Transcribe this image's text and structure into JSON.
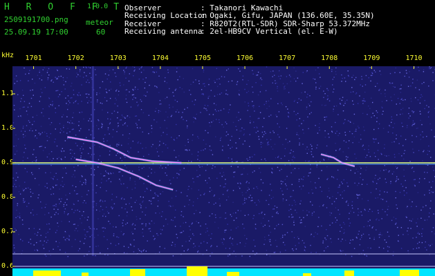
{
  "header": {
    "brand": "H R O F F T",
    "version": "1.0.0",
    "filename": "2509191700.png",
    "datetime": "25.09.19 17:00",
    "count_label": "meteor",
    "count_value": "60",
    "info": [
      {
        "label": "Observer",
        "value": ": Takanori Kawachi"
      },
      {
        "label": "Receiving Location",
        "value": ": Ogaki, Gifu, JAPAN (136.60E, 35.35N)"
      },
      {
        "label": "Receiver",
        "value": ": R820T2(RTL-SDR) SDR-Sharp 53.372MHz"
      },
      {
        "label": "Receiving antenna",
        "value": ": 2el-HB9CV Vertical (el. E-W)"
      }
    ]
  },
  "colors": {
    "background": "#000000",
    "plot_background": "#1a1a66",
    "tick_text": "#ffff33",
    "brand_green": "#30d030",
    "carrier": "#e0ff80",
    "meteor_trail": "#ff80ff",
    "bottom_noise": "#00e5ff",
    "bottom_peaks": "#ffff00"
  },
  "chart_data": {
    "type": "heatmap",
    "yunit": "kHz",
    "x_ticks": [
      "1701",
      "1702",
      "1703",
      "1704",
      "1705",
      "1706",
      "1707",
      "1708",
      "1709",
      "1710"
    ],
    "y_ticks": [
      "1.1",
      "1.0",
      "0.9",
      "0.8",
      "0.7",
      "0.6"
    ],
    "xlim": [
      1700.5,
      1710.5
    ],
    "ylim": [
      0.6,
      1.2
    ],
    "carrier_khz": 0.9,
    "traces": [
      {
        "points": [
          [
            1701.8,
            0.975
          ],
          [
            1702.5,
            0.96
          ],
          [
            1702.9,
            0.94
          ],
          [
            1703.3,
            0.915
          ],
          [
            1703.8,
            0.905
          ],
          [
            1704.5,
            0.9
          ]
        ]
      },
      {
        "points": [
          [
            1702.0,
            0.91
          ],
          [
            1702.5,
            0.9
          ],
          [
            1703.0,
            0.885
          ],
          [
            1703.5,
            0.86
          ],
          [
            1703.9,
            0.835
          ],
          [
            1704.3,
            0.822
          ]
        ]
      },
      {
        "points": [
          [
            1707.8,
            0.925
          ],
          [
            1708.1,
            0.915
          ],
          [
            1708.3,
            0.9
          ],
          [
            1708.6,
            0.89
          ]
        ]
      }
    ]
  }
}
